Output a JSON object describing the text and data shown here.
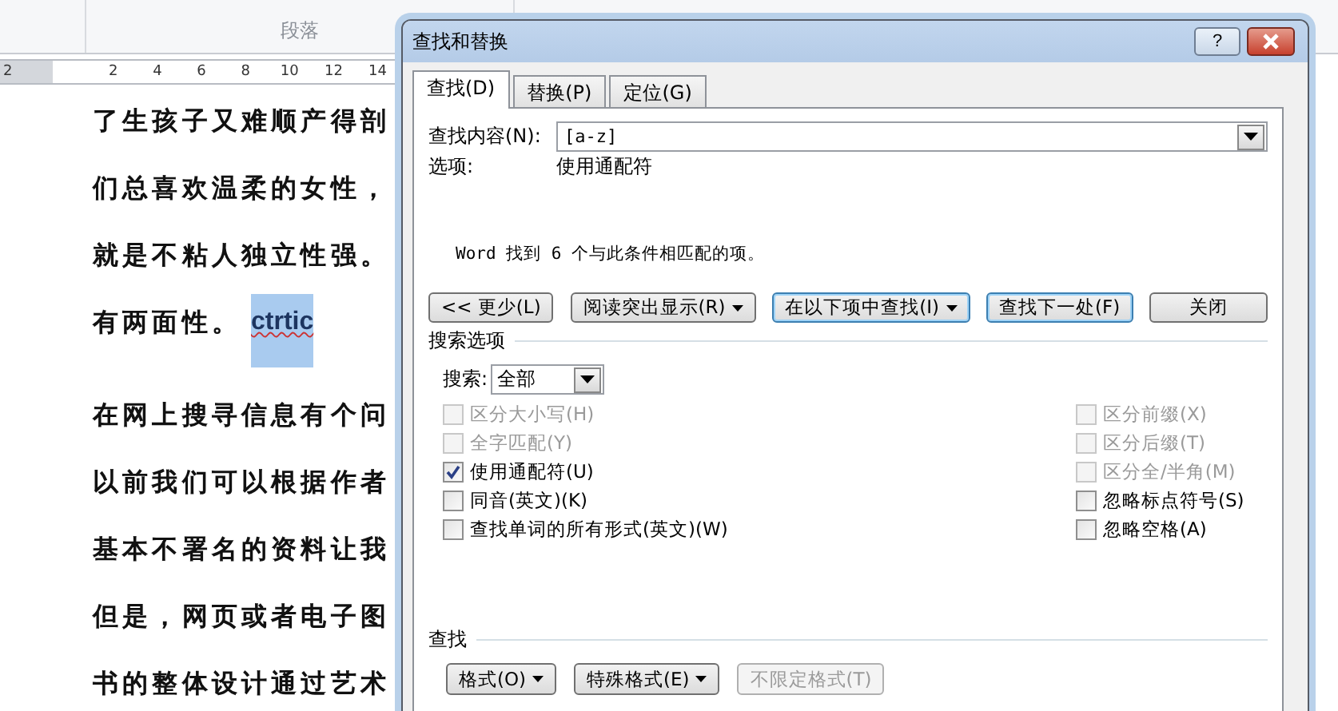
{
  "ribbon": {
    "group_label": "段落"
  },
  "ruler": {
    "ticks": [
      "2",
      "2",
      "4",
      "6",
      "8",
      "10",
      "12",
      "14"
    ]
  },
  "document": {
    "lines": [
      {
        "text": "了生孩子又难顺产得剖"
      },
      {
        "text": "们总喜欢温柔的女性，"
      },
      {
        "text": "就是不粘人独立性强。"
      },
      {
        "text": "有两面性。",
        "highlight": "ctrtic"
      },
      {
        "text": "在网上搜寻信息有个问"
      },
      {
        "text": "以前我们可以根据作者"
      },
      {
        "text": "基本不署名的资料让我"
      },
      {
        "text": "但是，网页或者电子图"
      },
      {
        "text": "书的整体设计通过艺术"
      }
    ]
  },
  "dialog": {
    "title": "查找和替换",
    "help": "?",
    "tabs": [
      {
        "label": "查找(D)",
        "selected": true
      },
      {
        "label": "替换(P)",
        "selected": false
      },
      {
        "label": "定位(G)",
        "selected": false
      }
    ],
    "find_what": {
      "label": "查找内容(N):",
      "value": "[a-z]"
    },
    "options": {
      "label": "选项:",
      "value": "使用通配符"
    },
    "message": "Word 找到 6 个与此条件相匹配的项。",
    "buttons": [
      {
        "label": "<< 更少(L)",
        "dropdown": false,
        "focused": false
      },
      {
        "label": "阅读突出显示(R)",
        "dropdown": true,
        "focused": false
      },
      {
        "label": "在以下项中查找(I)",
        "dropdown": true,
        "focused": true
      },
      {
        "label": "查找下一处(F)",
        "dropdown": false,
        "focused": true
      },
      {
        "label": "关闭",
        "dropdown": false,
        "focused": false
      }
    ],
    "search_options": {
      "title": "搜索选项",
      "search_label": "搜索:",
      "search_value": "全部",
      "left": [
        {
          "label": "区分大小写(H)",
          "checked": false,
          "disabled": true
        },
        {
          "label": "全字匹配(Y)",
          "checked": false,
          "disabled": true
        },
        {
          "label": "使用通配符(U)",
          "checked": true,
          "disabled": false
        },
        {
          "label": "同音(英文)(K)",
          "checked": false,
          "disabled": false
        },
        {
          "label": "查找单词的所有形式(英文)(W)",
          "checked": false,
          "disabled": false
        }
      ],
      "right": [
        {
          "label": "区分前缀(X)",
          "checked": false,
          "disabled": true
        },
        {
          "label": "区分后缀(T)",
          "checked": false,
          "disabled": true
        },
        {
          "label": "区分全/半角(M)",
          "checked": false,
          "disabled": true
        },
        {
          "label": "忽略标点符号(S)",
          "checked": false,
          "disabled": false
        },
        {
          "label": "忽略空格(A)",
          "checked": false,
          "disabled": false
        }
      ]
    },
    "find_section": {
      "title": "查找",
      "buttons": [
        {
          "label": "格式(O)",
          "dropdown": true,
          "disabled": false
        },
        {
          "label": "特殊格式(E)",
          "dropdown": true,
          "disabled": false
        },
        {
          "label": "不限定格式(T)",
          "dropdown": false,
          "disabled": true
        }
      ]
    }
  }
}
